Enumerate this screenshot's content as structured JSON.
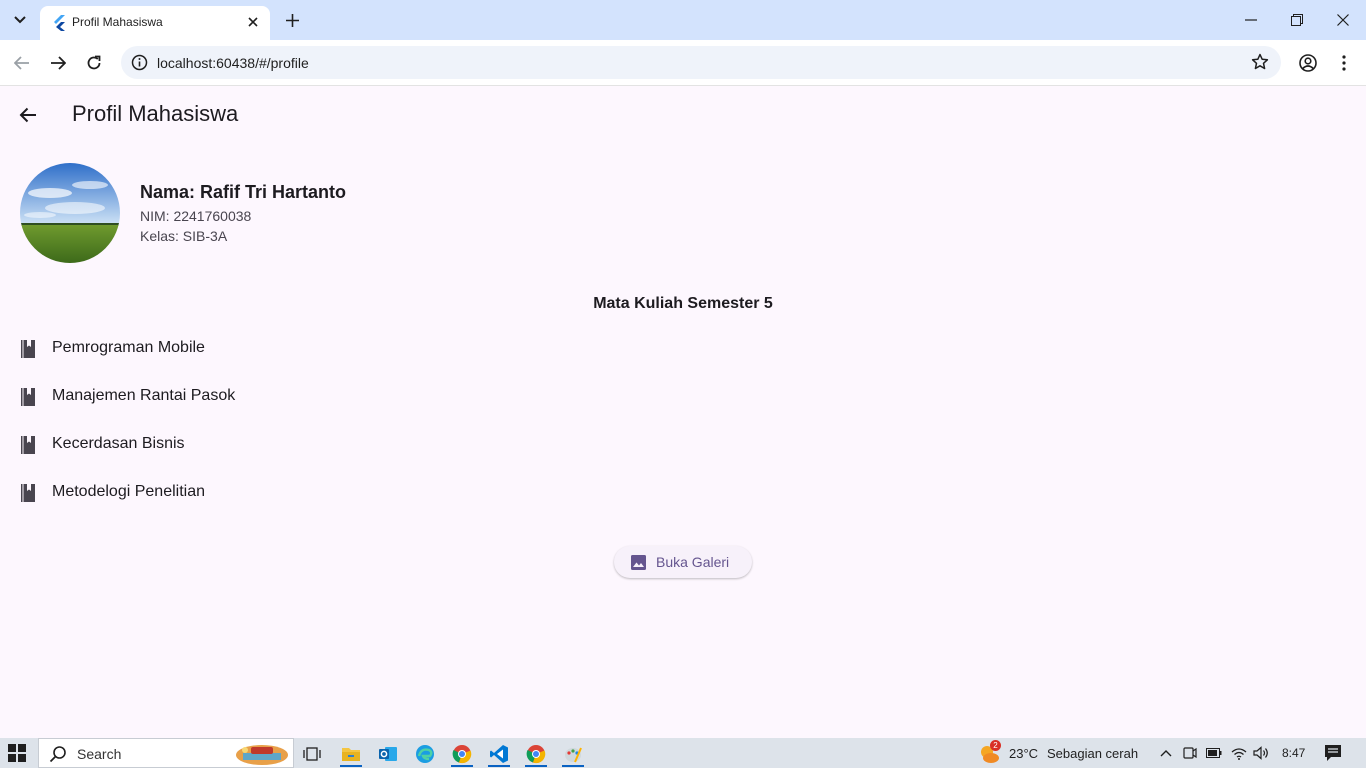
{
  "browser": {
    "tab_title": "Profil Mahasiswa",
    "url": "localhost:60438/#/profile"
  },
  "appbar": {
    "title": "Profil Mahasiswa"
  },
  "profile": {
    "name": "Nama: Rafif Tri Hartanto",
    "nim": "NIM: 2241760038",
    "kelas": "Kelas: SIB-3A"
  },
  "courses": {
    "title": "Mata Kuliah Semester 5",
    "items": [
      {
        "label": "Pemrograman Mobile",
        "icon": "book-icon"
      },
      {
        "label": "Manajemen Rantai Pasok",
        "icon": "book-icon"
      },
      {
        "label": "Kecerdasan Bisnis",
        "icon": "book-icon"
      },
      {
        "label": "Metodelogi Penelitian",
        "icon": "book-icon"
      }
    ]
  },
  "gallery_button": {
    "label": "Buka Galeri",
    "icon": "image-icon"
  },
  "taskbar": {
    "search_label": "Search",
    "weather_temp": "23°C",
    "weather_desc": "Sebagian cerah",
    "weather_badge": "2",
    "time": "8:47"
  },
  "colors": {
    "page_background": "#fdf7fe",
    "primary": "#65558f",
    "tabstrip": "#d3e3fd"
  }
}
